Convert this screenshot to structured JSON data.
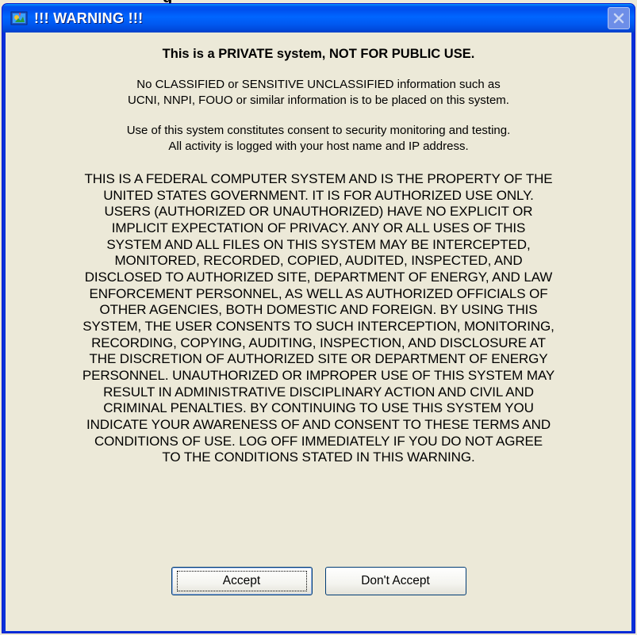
{
  "background_text": "g",
  "window": {
    "title": "!!! WARNING !!!",
    "icon": "app-icon",
    "close_label": "Close"
  },
  "content": {
    "heading": "This is a PRIVATE system, NOT FOR PUBLIC USE.",
    "para1_line1": "No CLASSIFIED or SENSITIVE UNCLASSIFIED information such as",
    "para1_line2": "UCNI, NNPI, FOUO or similar information is to be placed on this system.",
    "para2_line1": "Use of this system constitutes consent to security monitoring and testing.",
    "para2_line2": "All activity is logged with your host name and IP address.",
    "legal_lines": [
      "THIS IS A FEDERAL COMPUTER SYSTEM AND IS THE PROPERTY OF THE",
      "UNITED STATES GOVERNMENT. IT IS FOR AUTHORIZED USE ONLY.",
      "USERS (AUTHORIZED OR UNAUTHORIZED) HAVE NO EXPLICIT OR",
      "IMPLICIT EXPECTATION OF PRIVACY. ANY OR ALL USES OF THIS",
      "SYSTEM AND ALL FILES ON THIS SYSTEM MAY BE INTERCEPTED,",
      "MONITORED, RECORDED, COPIED, AUDITED, INSPECTED, AND",
      "DISCLOSED TO AUTHORIZED SITE, DEPARTMENT OF ENERGY, AND LAW",
      "ENFORCEMENT PERSONNEL, AS WELL AS AUTHORIZED OFFICIALS OF",
      "OTHER AGENCIES, BOTH DOMESTIC AND FOREIGN. BY USING THIS",
      "SYSTEM, THE USER CONSENTS TO SUCH INTERCEPTION, MONITORING,",
      "RECORDING, COPYING, AUDITING, INSPECTION, AND DISCLOSURE AT",
      "THE DISCRETION OF AUTHORIZED SITE OR DEPARTMENT OF ENERGY",
      "PERSONNEL. UNAUTHORIZED OR IMPROPER USE OF THIS SYSTEM MAY",
      "RESULT IN ADMINISTRATIVE DISCIPLINARY ACTION AND CIVIL AND",
      "CRIMINAL PENALTIES. BY CONTINUING TO USE THIS SYSTEM YOU",
      "INDICATE YOUR AWARENESS OF AND CONSENT TO THESE TERMS AND",
      "CONDITIONS OF USE. LOG OFF IMMEDIATELY IF YOU DO NOT AGREE",
      "TO THE CONDITIONS STATED IN THIS WARNING."
    ]
  },
  "buttons": {
    "accept": "Accept",
    "decline": "Don't Accept"
  },
  "colors": {
    "titlebar": "#0058ee",
    "dialog_bg": "#ece9d8",
    "button_border": "#003c74"
  }
}
